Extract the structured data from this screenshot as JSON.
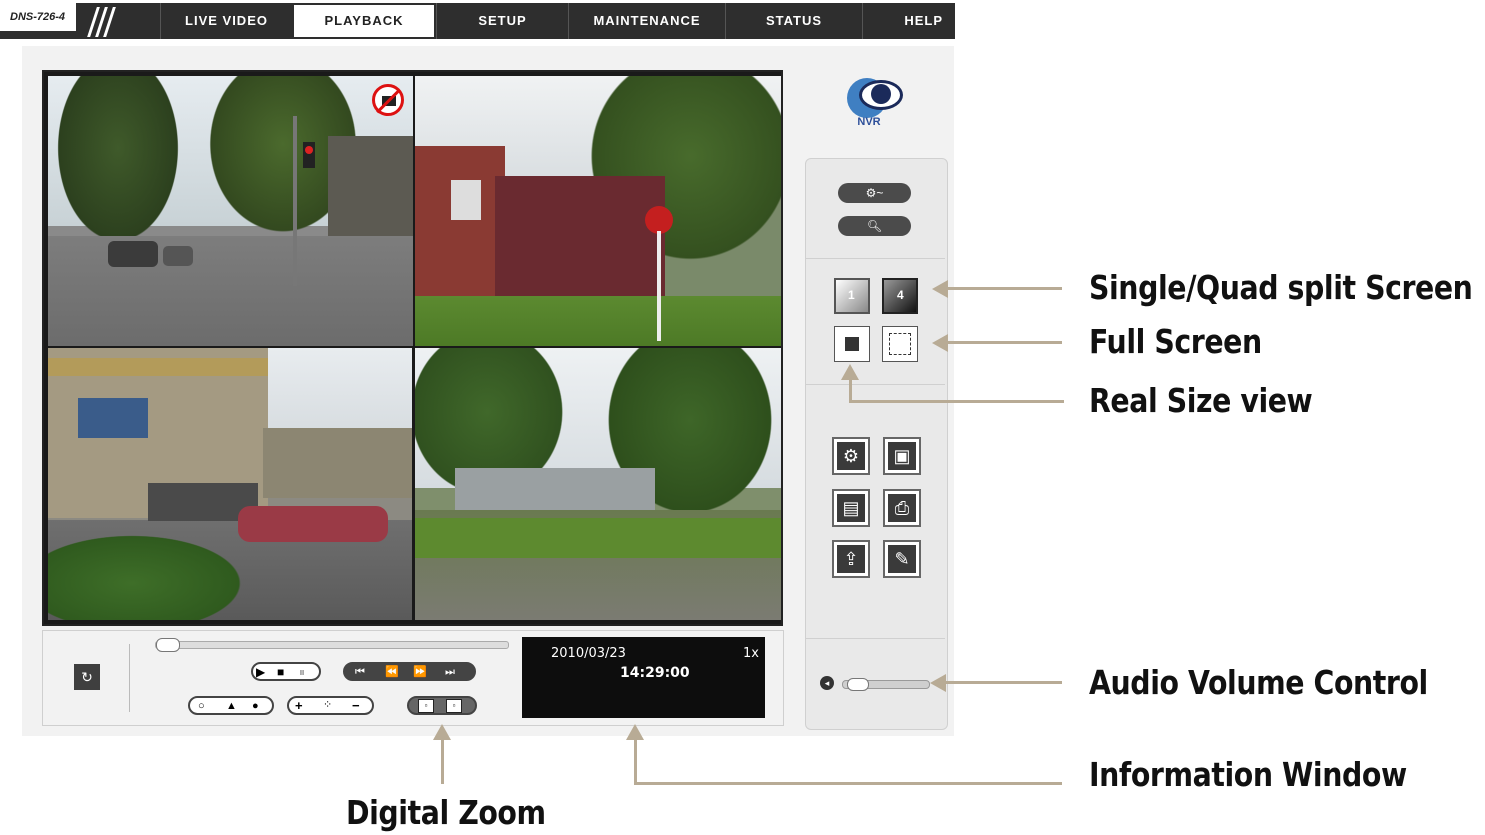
{
  "device_model": "DNS-726-4",
  "nav": {
    "tabs": [
      {
        "label": "LIVE VIDEO"
      },
      {
        "label": "PLAYBACK"
      },
      {
        "label": "SETUP"
      },
      {
        "label": "MAINTENANCE"
      },
      {
        "label": "STATUS"
      },
      {
        "label": "HELP"
      }
    ],
    "active_tab": "PLAYBACK"
  },
  "logo": {
    "text": "NVR"
  },
  "info_window": {
    "date": "2010/03/23",
    "time": "14:29:00",
    "speed": "1x"
  },
  "split_buttons": {
    "single_label": "1",
    "quad_label": "4"
  },
  "annotations": [
    {
      "label": "Single/Quad split Screen"
    },
    {
      "label": "Full Screen"
    },
    {
      "label": "Real Size view"
    },
    {
      "label": "Audio Volume Control"
    },
    {
      "label": "Information Window"
    },
    {
      "label": "Digital Zoom"
    }
  ],
  "colors": {
    "nav_bg": "#2e2e2e",
    "panel_bg": "#f2f2f2",
    "callout_line": "#b8ab95",
    "info_bg": "#0d0d0d"
  },
  "icons": [
    "camera-off-icon",
    "nvr-eye-logo-icon",
    "playback-record-icon",
    "search-icon",
    "single-view-icon",
    "quad-view-icon",
    "real-size-icon",
    "full-screen-icon",
    "settings-icon",
    "save-video-icon",
    "save-image-icon",
    "print-icon",
    "backup-icon",
    "edit-icon",
    "volume-icon",
    "sync-icon"
  ]
}
